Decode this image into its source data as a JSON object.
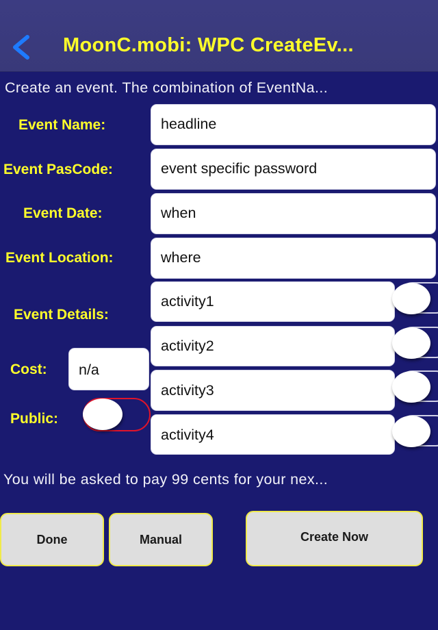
{
  "navbar": {
    "back_icon": "chevron-left-icon",
    "title": "MoonC.mobi: WPC CreateEv..."
  },
  "intro_text": "Create an event. The combination of EventNa...",
  "form": {
    "event_name": {
      "label": "Event Name:",
      "value": "headline"
    },
    "event_pascode": {
      "label": "Event PasCode:",
      "value": "event specific password"
    },
    "event_date": {
      "label": "Event Date:",
      "value": "when"
    },
    "event_location": {
      "label": "Event Location:",
      "value": "where"
    },
    "event_details": {
      "label": "Event Details:",
      "activities": [
        {
          "value": "activity1",
          "enabled": false
        },
        {
          "value": "activity2",
          "enabled": false
        },
        {
          "value": "activity3",
          "enabled": false
        },
        {
          "value": "activity4",
          "enabled": false
        }
      ]
    },
    "cost": {
      "label": "Cost:",
      "value": "n/a"
    },
    "public": {
      "label": "Public:",
      "enabled": false
    }
  },
  "payment_note": "You will be asked to pay 99 cents for your nex...",
  "buttons": {
    "done": "Done",
    "manual": "Manual",
    "create_now": "Create Now"
  },
  "colors": {
    "background": "#1a1a70",
    "navbar": "#3a3a7e",
    "label_yellow": "#ffff2a",
    "back_blue": "#1e7bff",
    "public_toggle_outline": "#e0142a",
    "button_border": "#f0ea4a"
  }
}
